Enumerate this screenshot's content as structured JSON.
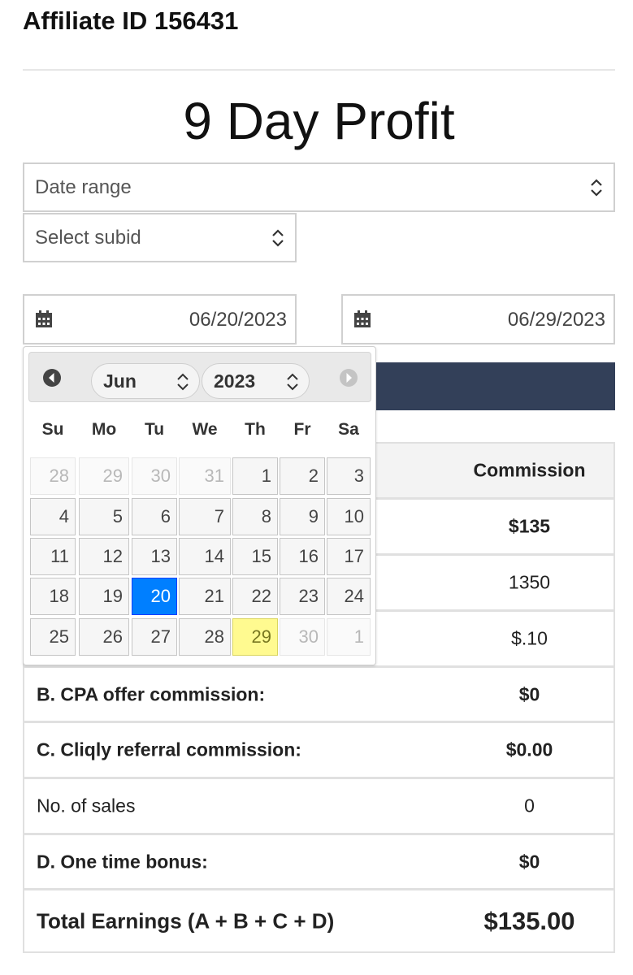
{
  "affiliate_label": "Affiliate ID 156431",
  "page_title": "9 Day Profit",
  "filters": {
    "date_range": "Date range",
    "subid": "Select subid"
  },
  "date_start": "06/20/2023",
  "date_end": "06/29/2023",
  "datepicker": {
    "month": "Jun",
    "year": "2023",
    "weekdays": [
      "Su",
      "Mo",
      "Tu",
      "We",
      "Th",
      "Fr",
      "Sa"
    ],
    "days": [
      [
        "28",
        "29",
        "30",
        "31",
        "1",
        "2",
        "3"
      ],
      [
        "4",
        "5",
        "6",
        "7",
        "8",
        "9",
        "10"
      ],
      [
        "11",
        "12",
        "13",
        "14",
        "15",
        "16",
        "17"
      ],
      [
        "18",
        "19",
        "20",
        "21",
        "22",
        "23",
        "24"
      ],
      [
        "25",
        "26",
        "27",
        "28",
        "29",
        "30",
        "1"
      ]
    ],
    "selected_day": "20",
    "today_day": "29"
  },
  "table": {
    "header_commission": "Commission",
    "rows": [
      {
        "label": "",
        "value": "$135"
      },
      {
        "label": "",
        "value": "1350"
      },
      {
        "label": "",
        "value": "$.10"
      },
      {
        "label": "B. CPA offer commission:",
        "value": "$0"
      },
      {
        "label": "C. Cliqly referral commission:",
        "value": "$0.00"
      },
      {
        "label": "No. of sales",
        "value": "0"
      },
      {
        "label": "D. One time bonus:",
        "value": "$0"
      }
    ],
    "total_label": "Total Earnings (A + B + C + D)",
    "total_value": "$135.00"
  },
  "colors": {
    "navy": "#334059",
    "selected": "#007fff",
    "today": "#fffa90"
  }
}
